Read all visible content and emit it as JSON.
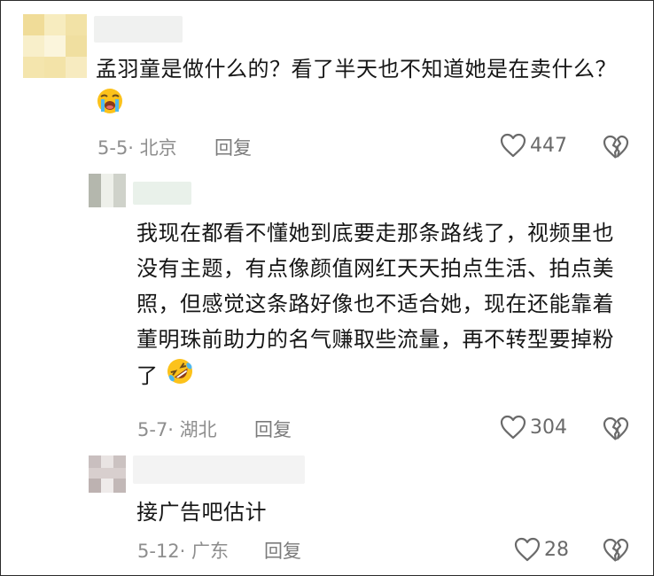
{
  "comments": [
    {
      "text": "孟羽童是做什么的？看了半天也不知道她是在卖什么？",
      "date_location": "5-5· 北京",
      "reply_label": "回复",
      "likes": "447",
      "emoji": "loudly-crying-face"
    },
    {
      "text": "我现在都看不懂她到底要走那条路线了，视频里也没有主题，有点像颜值网红天天拍点生活、拍点美照，但感觉这条路好像也不适合她，现在还能靠着董明珠前助力的名气赚取些流量，再不转型要掉粉了",
      "date_location": "5-7· 湖北",
      "reply_label": "回复",
      "likes": "304",
      "emoji": "rolling-on-floor-laughing"
    },
    {
      "text": "接广告吧估计",
      "date_location": "5-12· 广东",
      "reply_label": "回复",
      "likes": "28"
    }
  ],
  "colors": {
    "text": "#161616",
    "meta": "#8e8e8e",
    "icon": "#6a6a6a",
    "avatar_1": "#f3e3a6",
    "avatar_2": "#c9cbc4",
    "avatar_3": "#d7cfcf"
  },
  "icons": {
    "like": "heart-outline-icon",
    "dislike": "broken-heart-icon"
  }
}
